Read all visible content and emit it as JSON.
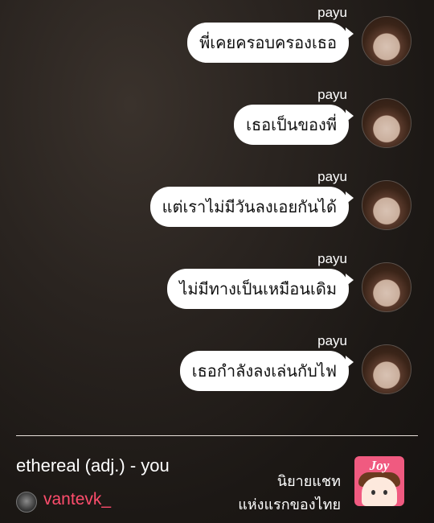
{
  "messages": [
    {
      "sender": "payu",
      "text": "พี่เคยครอบครองเธอ"
    },
    {
      "sender": "payu",
      "text": "เธอเป็นของพี่"
    },
    {
      "sender": "payu",
      "text": "แต่เราไม่มีวันลงเอยกันได้"
    },
    {
      "sender": "payu",
      "text": "ไม่มีทางเป็นเหมือนเดิม"
    },
    {
      "sender": "payu",
      "text": "เธอกำลังลงเล่นกับไฟ"
    }
  ],
  "footer": {
    "story_title": "ethereal (adj.) - you",
    "username": "vantevk_",
    "promo_line1": "นิยายแชท",
    "promo_line2": "แห่งแรกของไทย",
    "app_logo_text": "Joy"
  },
  "colors": {
    "bubble": "#ffffff",
    "username": "#ff4d6d",
    "app_logo": "#f05a80"
  },
  "icons": {
    "sender_avatar": "profile-photo",
    "user_avatar": "profile-photo",
    "app_logo": "joylada-app-icon"
  }
}
